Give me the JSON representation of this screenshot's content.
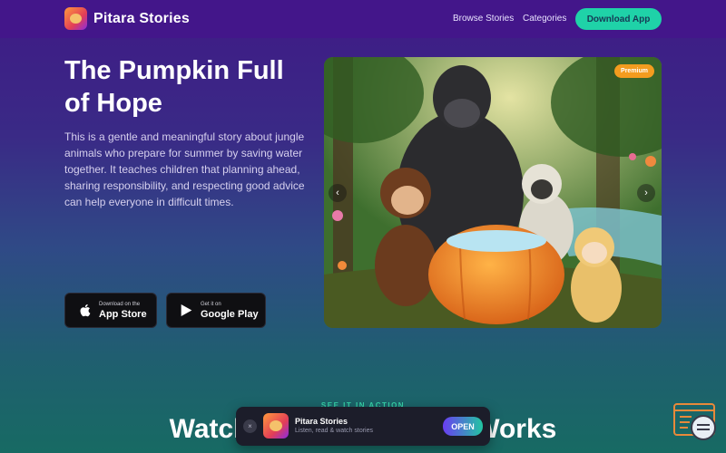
{
  "nav": {
    "brand": "Pitara Stories",
    "links": [
      "Browse Stories",
      "Categories"
    ],
    "cta": "Download App"
  },
  "hero": {
    "title": "The Pumpkin Full of Hope",
    "description": "This is a gentle and meaningful story about jungle animals who prepare for summer by saving water together. It teaches children that planning ahead, sharing responsibility, and respecting good advice can help everyone in difficult times.",
    "store_buttons": [
      {
        "small": "Download on the",
        "big": "App Store",
        "icon": "apple-icon"
      },
      {
        "small": "Get it on",
        "big": "Google Play",
        "icon": "play-store-icon"
      }
    ]
  },
  "carousel": {
    "badge": "Premium",
    "prev_icon": "chevron-left-icon",
    "next_icon": "chevron-right-icon"
  },
  "section": {
    "eyebrow": "SEE IT IN ACTION",
    "title_left": "Watch",
    "title_right": "Works"
  },
  "app_banner": {
    "close": "×",
    "name": "Pitara Stories",
    "subtitle": "Listen, read & watch stories",
    "open": "OPEN"
  },
  "colors": {
    "accent": "#1fd2a8",
    "premium": "#f39c1f",
    "nav_bg": "#43168a"
  }
}
